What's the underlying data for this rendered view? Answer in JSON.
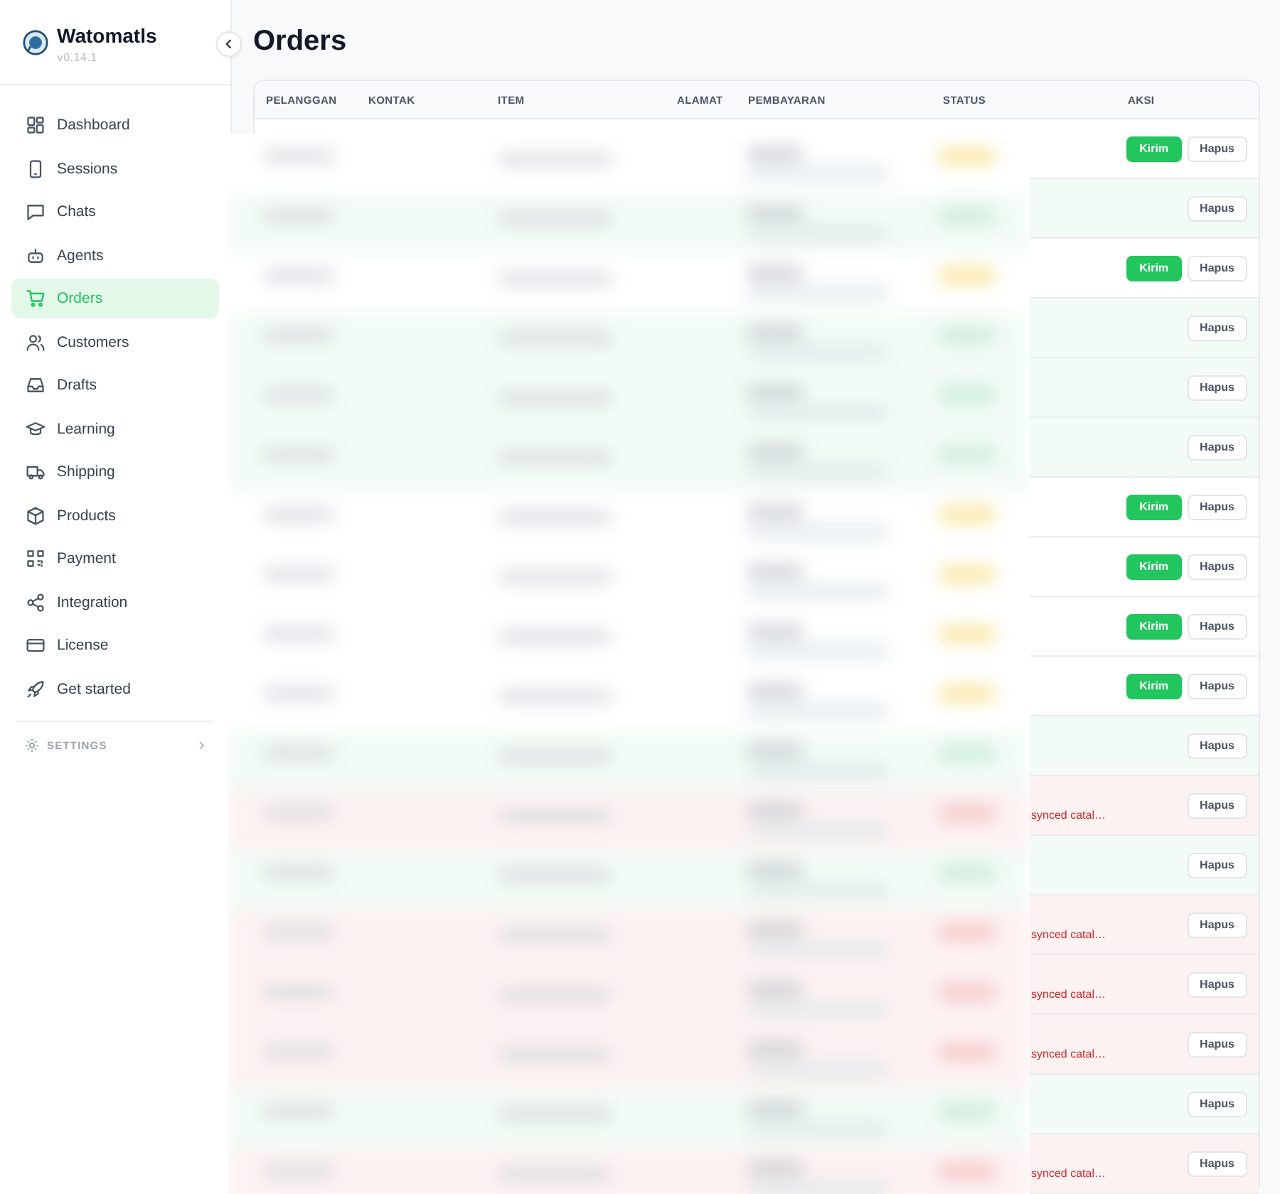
{
  "app": {
    "name": "Watomatls",
    "version": "v0.14.1"
  },
  "sidebar": {
    "items": [
      {
        "label": "Dashboard",
        "selected": false
      },
      {
        "label": "Sessions",
        "selected": false
      },
      {
        "label": "Chats",
        "selected": false
      },
      {
        "label": "Agents",
        "selected": false
      },
      {
        "label": "Orders",
        "selected": true
      },
      {
        "label": "Customers",
        "selected": false
      },
      {
        "label": "Drafts",
        "selected": false
      },
      {
        "label": "Learning",
        "selected": false
      },
      {
        "label": "Shipping",
        "selected": false
      },
      {
        "label": "Products",
        "selected": false
      },
      {
        "label": "Payment",
        "selected": false
      },
      {
        "label": "Integration",
        "selected": false
      },
      {
        "label": "License",
        "selected": false
      },
      {
        "label": "Get started",
        "selected": false
      }
    ],
    "settings": {
      "label": "SETTINGS",
      "expanded": false
    }
  },
  "page": {
    "title": "Orders"
  },
  "table": {
    "columns": [
      "PELANGGAN",
      "KONTAK",
      "ITEM",
      "ALAMAT",
      "PEMBAYARAN",
      "STATUS",
      "AKSI"
    ],
    "rows": [
      {
        "kind": "pending",
        "actions": [
          {
            "label": "Kirim",
            "kind": "primary"
          },
          {
            "label": "Hapus",
            "kind": "outline"
          }
        ]
      },
      {
        "kind": "paid",
        "actions": [
          {
            "label": "Hapus",
            "kind": "outline"
          }
        ]
      },
      {
        "kind": "pending",
        "actions": [
          {
            "label": "Kirim",
            "kind": "primary"
          },
          {
            "label": "Hapus",
            "kind": "outline"
          }
        ]
      },
      {
        "kind": "paid",
        "actions": [
          {
            "label": "Hapus",
            "kind": "outline"
          }
        ]
      },
      {
        "kind": "paid",
        "actions": [
          {
            "label": "Hapus",
            "kind": "outline"
          }
        ]
      },
      {
        "kind": "paid",
        "actions": [
          {
            "label": "Hapus",
            "kind": "outline"
          }
        ]
      },
      {
        "kind": "pending",
        "actions": [
          {
            "label": "Kirim",
            "kind": "primary"
          },
          {
            "label": "Hapus",
            "kind": "outline"
          }
        ]
      },
      {
        "kind": "pending",
        "actions": [
          {
            "label": "Kirim",
            "kind": "primary"
          },
          {
            "label": "Hapus",
            "kind": "outline"
          }
        ]
      },
      {
        "kind": "pending",
        "actions": [
          {
            "label": "Kirim",
            "kind": "primary"
          },
          {
            "label": "Hapus",
            "kind": "outline"
          }
        ]
      },
      {
        "kind": "pending",
        "actions": [
          {
            "label": "Kirim",
            "kind": "primary"
          },
          {
            "label": "Hapus",
            "kind": "outline"
          }
        ]
      },
      {
        "kind": "paid",
        "actions": [
          {
            "label": "Hapus",
            "kind": "outline"
          }
        ]
      },
      {
        "kind": "failed",
        "note": "synced catal…",
        "actions": [
          {
            "label": "Hapus",
            "kind": "outline"
          }
        ]
      },
      {
        "kind": "paid",
        "actions": [
          {
            "label": "Hapus",
            "kind": "outline"
          }
        ]
      },
      {
        "kind": "failed",
        "note": "synced catal…",
        "actions": [
          {
            "label": "Hapus",
            "kind": "outline"
          }
        ]
      },
      {
        "kind": "failed",
        "note": "synced catal…",
        "actions": [
          {
            "label": "Hapus",
            "kind": "outline"
          }
        ]
      },
      {
        "kind": "failed",
        "note": "synced catal…",
        "actions": [
          {
            "label": "Hapus",
            "kind": "outline"
          }
        ]
      },
      {
        "kind": "paid",
        "actions": [
          {
            "label": "Hapus",
            "kind": "outline"
          }
        ]
      },
      {
        "kind": "failed",
        "note": "synced catal…",
        "actions": [
          {
            "label": "Hapus",
            "kind": "outline"
          }
        ]
      }
    ]
  }
}
